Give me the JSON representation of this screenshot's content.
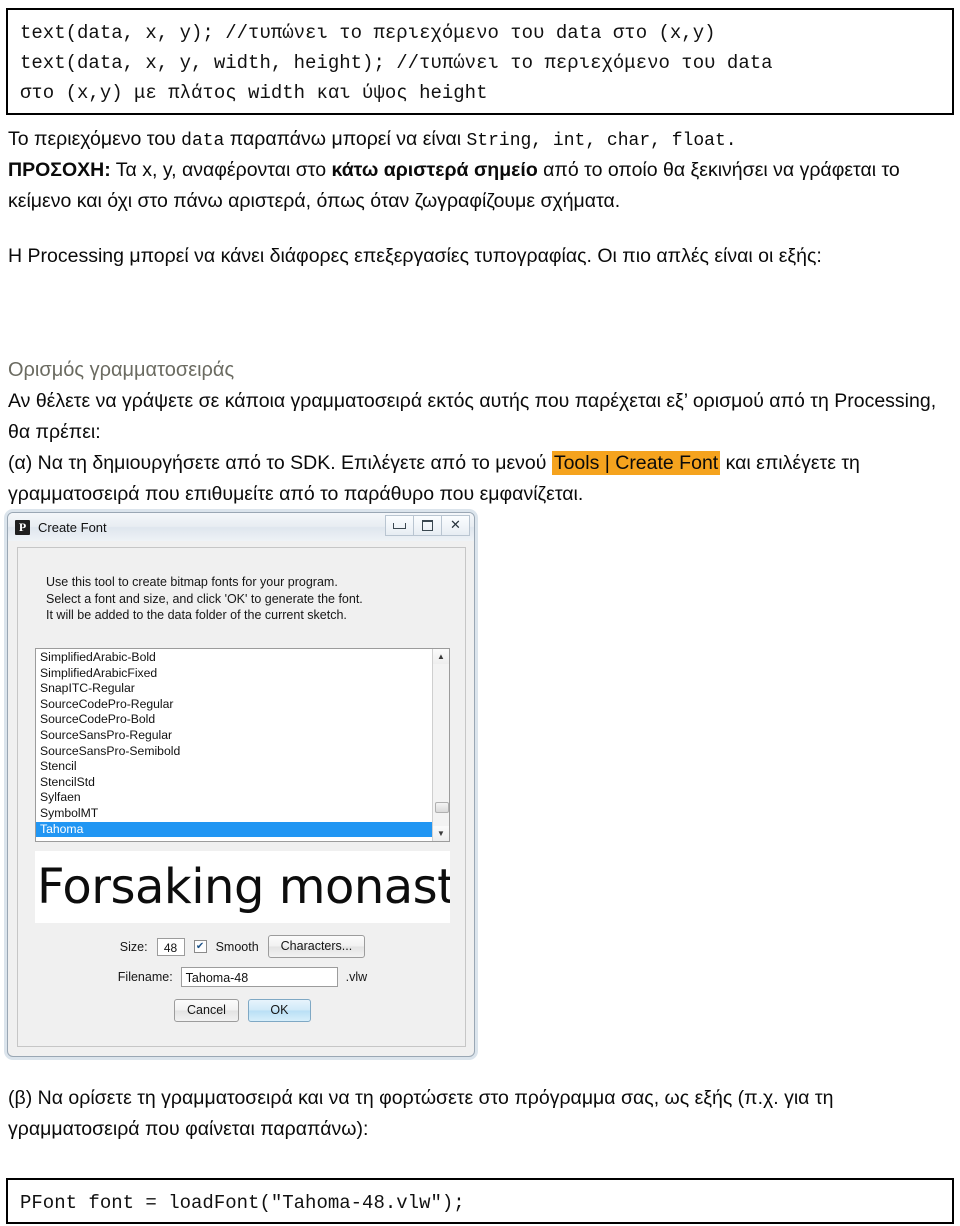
{
  "code_top": {
    "lines": [
      "text(data, x, y); //τυπώνει το περιεχόμενο του data στο (x,y)",
      "text(data, x, y, width, height); //τυπώνει το περιεχόμενο του data",
      "στο (x,y) με πλάτος width και ύψος height"
    ]
  },
  "body": {
    "p1_a": "Το περιεχόμενο του ",
    "p1_mono1": "data",
    "p1_b": "  παραπάνω μπορεί να είναι ",
    "p1_mono2": "String, int, char, float.",
    "p2_label": "ΠΡΟΣΟΧΗ:",
    "p2_a": " Τα x, y, αναφέρονται στο ",
    "p2_bold": "κάτω αριστερά σημείο",
    "p2_b": " από το οποίο θα ξεκινήσει να γράφεται το κείμενο και όχι στο πάνω αριστερά, όπως όταν ζωγραφίζουμε σχήματα.",
    "p3": "Η Processing μπορεί να κάνει διάφορες επεξεργασίες τυπογραφίας. Οι πιο απλές είναι οι εξής:",
    "heading": "Ορισμός γραμματοσειράς",
    "p4": "Αν θέλετε να γράψετε σε κάποια γραμματοσειρά εκτός αυτής που παρέχεται εξ’ ορισμού από τη Processing, θα πρέπει:",
    "p5_a": "(α) Να τη δημιουργήσετε από το SDK. Επιλέγετε από το μενού ",
    "p5_menu": "Tools | Create Font",
    "p5_b": " και επιλέγετε τη γραμματοσειρά που επιθυμείτε από το παράθυρο που εμφανίζεται.",
    "p6": "(β) Να ορίσετε τη γραμματοσειρά και να τη φορτώσετε στο πρόγραμμα σας, ως εξής (π.χ. για τη γραμματοσειρά που φαίνεται παραπάνω):"
  },
  "code_bottom": {
    "line": "PFont font = loadFont(\"Tahoma-48.vlw\");"
  },
  "dialog": {
    "app_icon_letter": "P",
    "title": "Create Font",
    "window_buttons": {
      "minimize": "minimize-icon",
      "maximize": "maximize-icon",
      "close": "✕"
    },
    "blurb": [
      "Use this tool to create bitmap fonts for your program.",
      "Select a font and size, and click 'OK' to generate the font.",
      "It will be added to the data folder of the current sketch."
    ],
    "font_list": {
      "items": [
        "SimplifiedArabic-Bold",
        "SimplifiedArabicFixed",
        "SnapITC-Regular",
        "SourceCodePro-Regular",
        "SourceCodePro-Bold",
        "SourceSansPro-Regular",
        "SourceSansPro-Semibold",
        "Stencil",
        "StencilStd",
        "Sylfaen",
        "SymbolMT",
        "Tahoma"
      ],
      "selected": "Tahoma",
      "scroll_up_glyph": "▲",
      "scroll_down_glyph": "▼"
    },
    "preview_text": "Forsaking monastic",
    "size_label": "Size:",
    "size_value": "48",
    "smooth_label": "Smooth",
    "smooth_checked": true,
    "smooth_check_glyph": "✔",
    "characters_button": "Characters...",
    "filename_label": "Filename:",
    "filename_value": "Tahoma-48",
    "filename_extension": ".vlw",
    "cancel_button": "Cancel",
    "ok_button": "OK"
  },
  "colors": {
    "menu_highlight": "#f5a31e",
    "heading": "#6b6b61",
    "list_selection": "#2196f3"
  }
}
